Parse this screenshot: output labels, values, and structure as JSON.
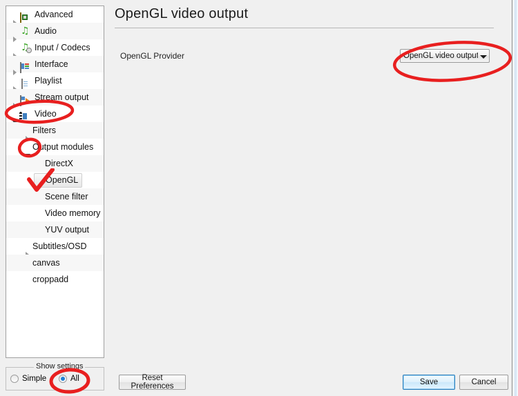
{
  "window": {
    "accent_blue": "#1e7fd4",
    "annotation_color": "#e81f1f",
    "panel_bg": "#f0f0f0"
  },
  "sidebar": {
    "name": "preferences-tree",
    "items": [
      {
        "label": "Advanced",
        "icon": "chip-icon",
        "indent": 0,
        "expander": "closed",
        "selected": false
      },
      {
        "label": "Audio",
        "icon": "music-note-icon",
        "indent": 0,
        "expander": "closed",
        "selected": false
      },
      {
        "label": "Input / Codecs",
        "icon": "input-codecs-icon",
        "indent": 0,
        "expander": "closed",
        "selected": false
      },
      {
        "label": "Interface",
        "icon": "window-icon",
        "indent": 0,
        "expander": "closed",
        "selected": false
      },
      {
        "label": "Playlist",
        "icon": "document-icon",
        "indent": 0,
        "expander": "closed",
        "selected": false
      },
      {
        "label": "Stream output",
        "icon": "stream-output-icon",
        "indent": 0,
        "expander": "closed",
        "selected": false
      },
      {
        "label": "Video",
        "icon": "film-strip-icon",
        "indent": 0,
        "expander": "open",
        "selected": false
      },
      {
        "label": "Filters",
        "icon": "none",
        "indent": 1,
        "expander": "closed",
        "selected": false
      },
      {
        "label": "Output modules",
        "icon": "none",
        "indent": 1,
        "expander": "open",
        "selected": false
      },
      {
        "label": "DirectX",
        "icon": "none",
        "indent": 2,
        "expander": "none",
        "selected": false
      },
      {
        "label": "OpenGL",
        "icon": "none",
        "indent": 2,
        "expander": "none",
        "selected": true
      },
      {
        "label": "Scene filter",
        "icon": "none",
        "indent": 2,
        "expander": "none",
        "selected": false
      },
      {
        "label": "Video memory",
        "icon": "none",
        "indent": 2,
        "expander": "none",
        "selected": false
      },
      {
        "label": "YUV output",
        "icon": "none",
        "indent": 2,
        "expander": "none",
        "selected": false
      },
      {
        "label": "Subtitles/OSD",
        "icon": "none",
        "indent": 1,
        "expander": "closed",
        "selected": false
      },
      {
        "label": "canvas",
        "icon": "none",
        "indent": 1,
        "expander": "none",
        "selected": false
      },
      {
        "label": "croppadd",
        "icon": "none",
        "indent": 1,
        "expander": "none",
        "selected": false
      }
    ]
  },
  "main": {
    "title": "OpenGL video output",
    "field_label": "OpenGL Provider",
    "combo_value": "OpenGL video output",
    "combo_arrow_icon": "chevron-down-icon"
  },
  "show_settings": {
    "group_title": "Show settings",
    "simple_label": "Simple",
    "all_label": "All",
    "selected": "All"
  },
  "buttons": {
    "reset": "Reset Preferences",
    "save": "Save",
    "cancel": "Cancel"
  },
  "annotations": [
    {
      "name": "video-circle-annotation",
      "shape": "ellipse"
    },
    {
      "name": "output-modules-circle-annotation",
      "shape": "ellipse"
    },
    {
      "name": "opengl-checkmark-annotation",
      "shape": "checkmark"
    },
    {
      "name": "combo-circle-annotation",
      "shape": "ellipse"
    },
    {
      "name": "all-radio-circle-annotation",
      "shape": "ellipse"
    }
  ]
}
